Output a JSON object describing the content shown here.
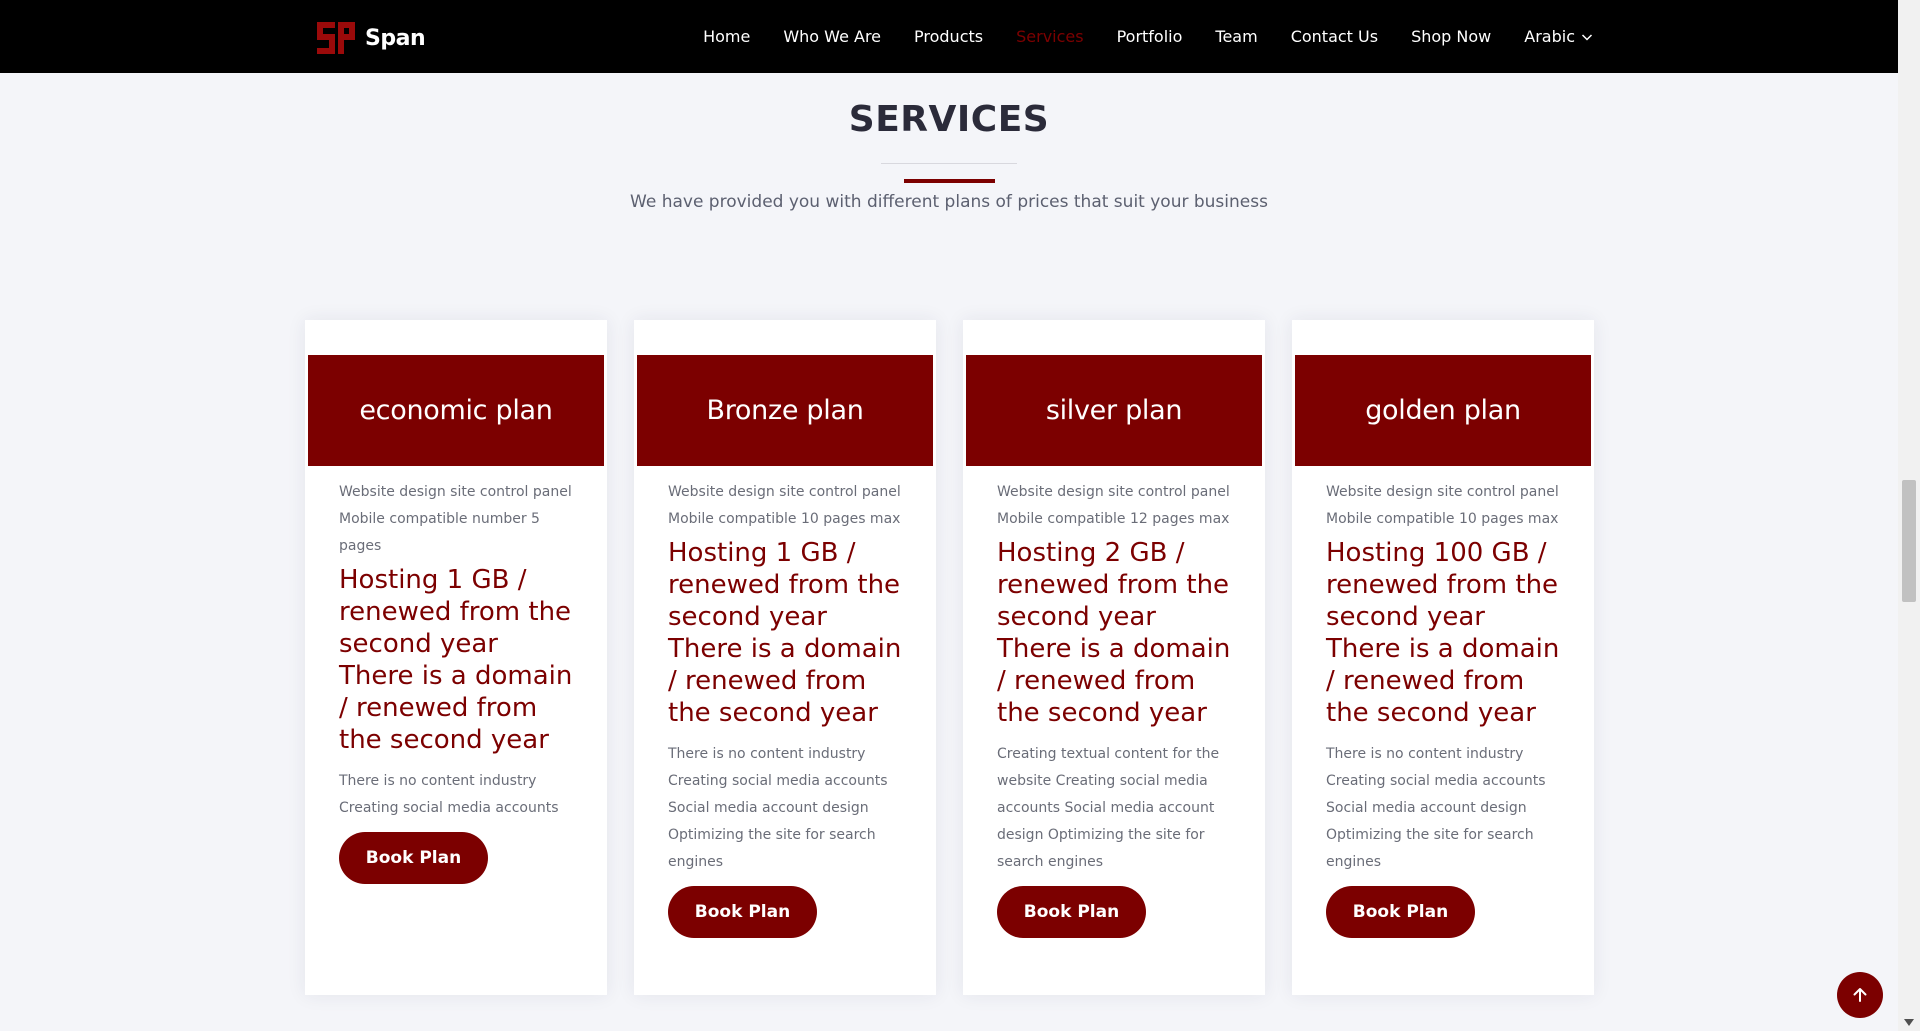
{
  "brand": {
    "name": "Span",
    "logo_icon": "sp-logo-icon"
  },
  "nav": {
    "items": [
      {
        "label": "Home"
      },
      {
        "label": "Who We Are"
      },
      {
        "label": "Products"
      },
      {
        "label": "Services",
        "active": true
      },
      {
        "label": "Portfolio"
      },
      {
        "label": "Team"
      },
      {
        "label": "Contact Us"
      },
      {
        "label": "Shop Now"
      },
      {
        "label": "Arabic",
        "icon": "chevron-down-icon"
      }
    ]
  },
  "section": {
    "title": "SERVICES",
    "subtitle": "We have provided you with different plans of prices that suit your business"
  },
  "plans": [
    {
      "name": "economic plan",
      "features_top": [
        "Website design site control panel",
        "Mobile compatible number 5 pages"
      ],
      "highlight": "Hosting 1 GB / renewed from the second year There is a domain / renewed from the second year",
      "features_bottom": "There is no content industry Creating social media accounts",
      "button": "Book Plan"
    },
    {
      "name": "Bronze plan",
      "features_top": [
        "Website design site control panel",
        "Mobile compatible 10 pages max"
      ],
      "highlight": "Hosting 1 GB / renewed from the second year There is a domain / renewed from the second year",
      "features_bottom": "There is no content industry Creating social media accounts Social media account design Optimizing the site for search engines",
      "button": "Book Plan"
    },
    {
      "name": "silver plan",
      "features_top": [
        "Website design site control panel",
        "Mobile compatible 12 pages max"
      ],
      "highlight": "Hosting 2 GB / renewed from the second year There is a domain / renewed from the second year",
      "features_bottom": "Creating textual content for the website Creating social media accounts Social media account design Optimizing the site for search engines",
      "button": "Book Plan"
    },
    {
      "name": "golden plan",
      "features_top": [
        "Website design site control panel",
        "Mobile compatible 10 pages max"
      ],
      "highlight": "Hosting 100 GB / renewed from the second year There is a domain / renewed from the second year",
      "features_bottom": "There is no content industry Creating social media accounts Social media account design Optimizing the site for search engines",
      "button": "Book Plan"
    }
  ],
  "colors": {
    "accent": "#7c0000",
    "header_bg": "#000000",
    "page_bg": "#f4f5f9"
  },
  "back_to_top": {
    "icon": "arrow-up-icon"
  }
}
